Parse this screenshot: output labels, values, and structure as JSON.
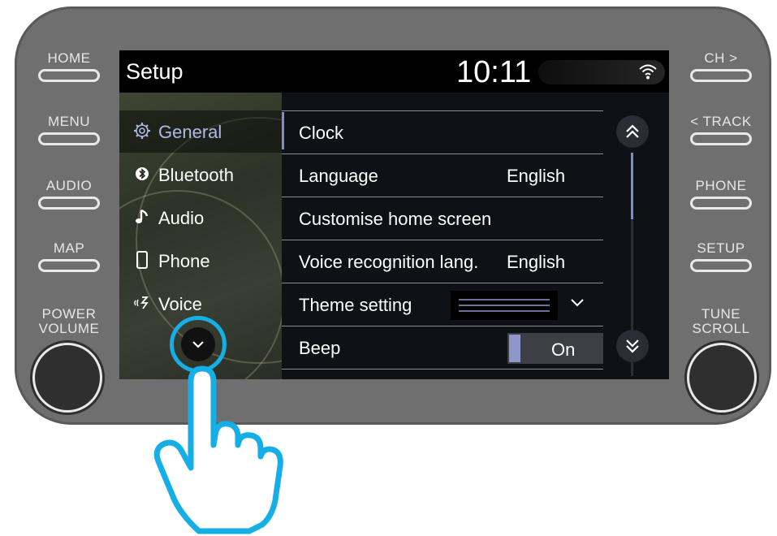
{
  "hardware": {
    "left_buttons": [
      "HOME",
      "MENU",
      "AUDIO",
      "MAP"
    ],
    "right_buttons": [
      "CH >",
      "< TRACK",
      "PHONE",
      "SETUP"
    ],
    "left_knob": [
      "POWER",
      "VOLUME"
    ],
    "right_knob": [
      "TUNE",
      "SCROLL"
    ]
  },
  "status_bar": {
    "title": "Setup",
    "time": "10:11",
    "wifi_icon": "wifi-icon"
  },
  "sidebar": {
    "items": [
      {
        "label": "General",
        "icon": "gear-icon",
        "active": true
      },
      {
        "label": "Bluetooth",
        "icon": "bluetooth-icon"
      },
      {
        "label": "Audio",
        "icon": "music-note-icon"
      },
      {
        "label": "Phone",
        "icon": "phone-icon"
      },
      {
        "label": "Voice",
        "icon": "voice-icon"
      }
    ],
    "more_icon": "chevron-down-icon"
  },
  "settings": {
    "rows": [
      {
        "label": "Clock",
        "value": ""
      },
      {
        "label": "Language",
        "value": "English"
      },
      {
        "label": "Customise home screen",
        "value": ""
      },
      {
        "label": "Voice recognition lang.",
        "value": "English"
      },
      {
        "label": "Theme setting",
        "value": ""
      },
      {
        "label": "Beep",
        "value": "On"
      }
    ],
    "beep_state": true
  },
  "colors": {
    "accent": "#7e8bd0",
    "highlight_ring": "#16aee6",
    "bezel": "#6f6f6f"
  }
}
